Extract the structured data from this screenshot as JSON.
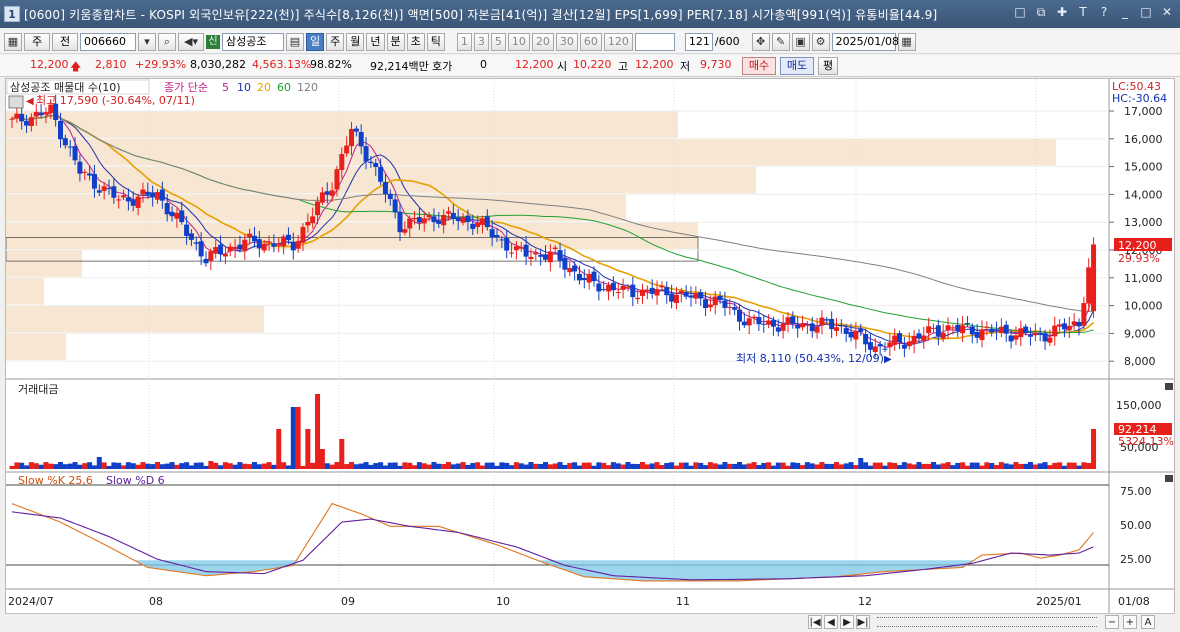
{
  "window": {
    "app_number": "1",
    "title": "[0600] 키움종합차트 - KOSPI 외국인보유[222(천)] 주식수[8,126(천)] 액면[500] 자본금[41(억)] 결산[12월] EPS[1,699] PER[7.18] 시가총액[991(억)] 유통비율[44.9]",
    "controls": [
      "□",
      "⧉",
      "✚",
      "T",
      "?",
      "_",
      "□",
      "✕"
    ]
  },
  "toolbar": {
    "period_select": "주",
    "market_select": "전",
    "stock_code": "006660",
    "stock_name": "삼성공조",
    "sin_badge": "신",
    "period_buttons": [
      "일",
      "주",
      "월",
      "년",
      "분",
      "초",
      "틱"
    ],
    "selected_period": "일",
    "interval_buttons": [
      "1",
      "3",
      "5",
      "10",
      "20",
      "30",
      "60",
      "120"
    ],
    "count_display": "121",
    "count_total": "/600",
    "date": "2025/01/08"
  },
  "price_row": {
    "price": "12,200",
    "change": "2,810",
    "change_pct": "+29.93%",
    "volume": "8,030,282",
    "volume_pct": "4,563.13%",
    "ratio": "98.82%",
    "trade_amount": "92,214백만",
    "hoga_label": "호가",
    "hoga_value": "0",
    "ask": "12,200",
    "open_label": "시",
    "open": "10,220",
    "high_label": "고",
    "high": "12,200",
    "low_label": "저",
    "low": "9,730",
    "buy_button": "매수",
    "sell_button": "매도",
    "flat_button": "평"
  },
  "main_chart": {
    "legend_title": "삼성공조 매물대 수(10)",
    "ma_label": "종가 단순",
    "ma_periods": [
      "5",
      "10",
      "20",
      "60",
      "120"
    ],
    "ma_colors": [
      "#c0208c",
      "#2030b0",
      "#e8a000",
      "#20a030",
      "#808080"
    ],
    "high_annotation": "최고 17,590 (-30.64%, 07/11)",
    "low_annotation": "최저 8,110 (50.43%, 12/09)",
    "lc_label": "LC:50.43",
    "hc_label": "HC:-30.64",
    "current_price_tag": "12,200",
    "current_pct_tag": "29.93%",
    "y_axis_ticks": [
      "17,000",
      "16,000",
      "15,000",
      "14,000",
      "13,000",
      "12,000",
      "11,000",
      "10,000",
      "9,000",
      "8,000"
    ]
  },
  "volume_chart": {
    "title": "거래대금",
    "y_axis_ticks": [
      "150,000",
      "50,000"
    ],
    "current_tag": "92,214",
    "current_pct_tag": "5324.13%"
  },
  "stoch_chart": {
    "title_k": "Slow %K 25,6",
    "title_d": "Slow %D 6",
    "y_axis_ticks": [
      "75.00",
      "50.00",
      "25.00"
    ]
  },
  "x_axis": {
    "labels": [
      "2024/07",
      "08",
      "09",
      "10",
      "11",
      "12",
      "2025/01",
      "01/08"
    ]
  },
  "scroll_controls": [
    "|◀",
    "◀",
    "▶",
    "▶|",
    "−",
    "+",
    "A"
  ],
  "chart_data": {
    "type": "candlestick",
    "x_dates": [
      "2024/07",
      "08",
      "09",
      "10",
      "11",
      "12",
      "2025/01"
    ],
    "ohlc_approx": [
      {
        "period": "2024/07 early",
        "close": 16800,
        "high": 17590
      },
      {
        "period": "2024/07 late",
        "close": 14000
      },
      {
        "period": "2024/08 early",
        "close": 11700,
        "low": 10600
      },
      {
        "period": "2024/08 late",
        "close": 14200,
        "high": 17100
      },
      {
        "period": "2024/09",
        "close": 13000
      },
      {
        "period": "2024/10",
        "close": 11000
      },
      {
        "period": "2024/11",
        "close": 9400
      },
      {
        "period": "2024/12 early",
        "close": 8500,
        "low": 8110
      },
      {
        "period": "2025/01/08",
        "open": 10220,
        "high": 12200,
        "low": 9730,
        "close": 12200
      }
    ],
    "ylim": [
      7800,
      17800
    ]
  }
}
